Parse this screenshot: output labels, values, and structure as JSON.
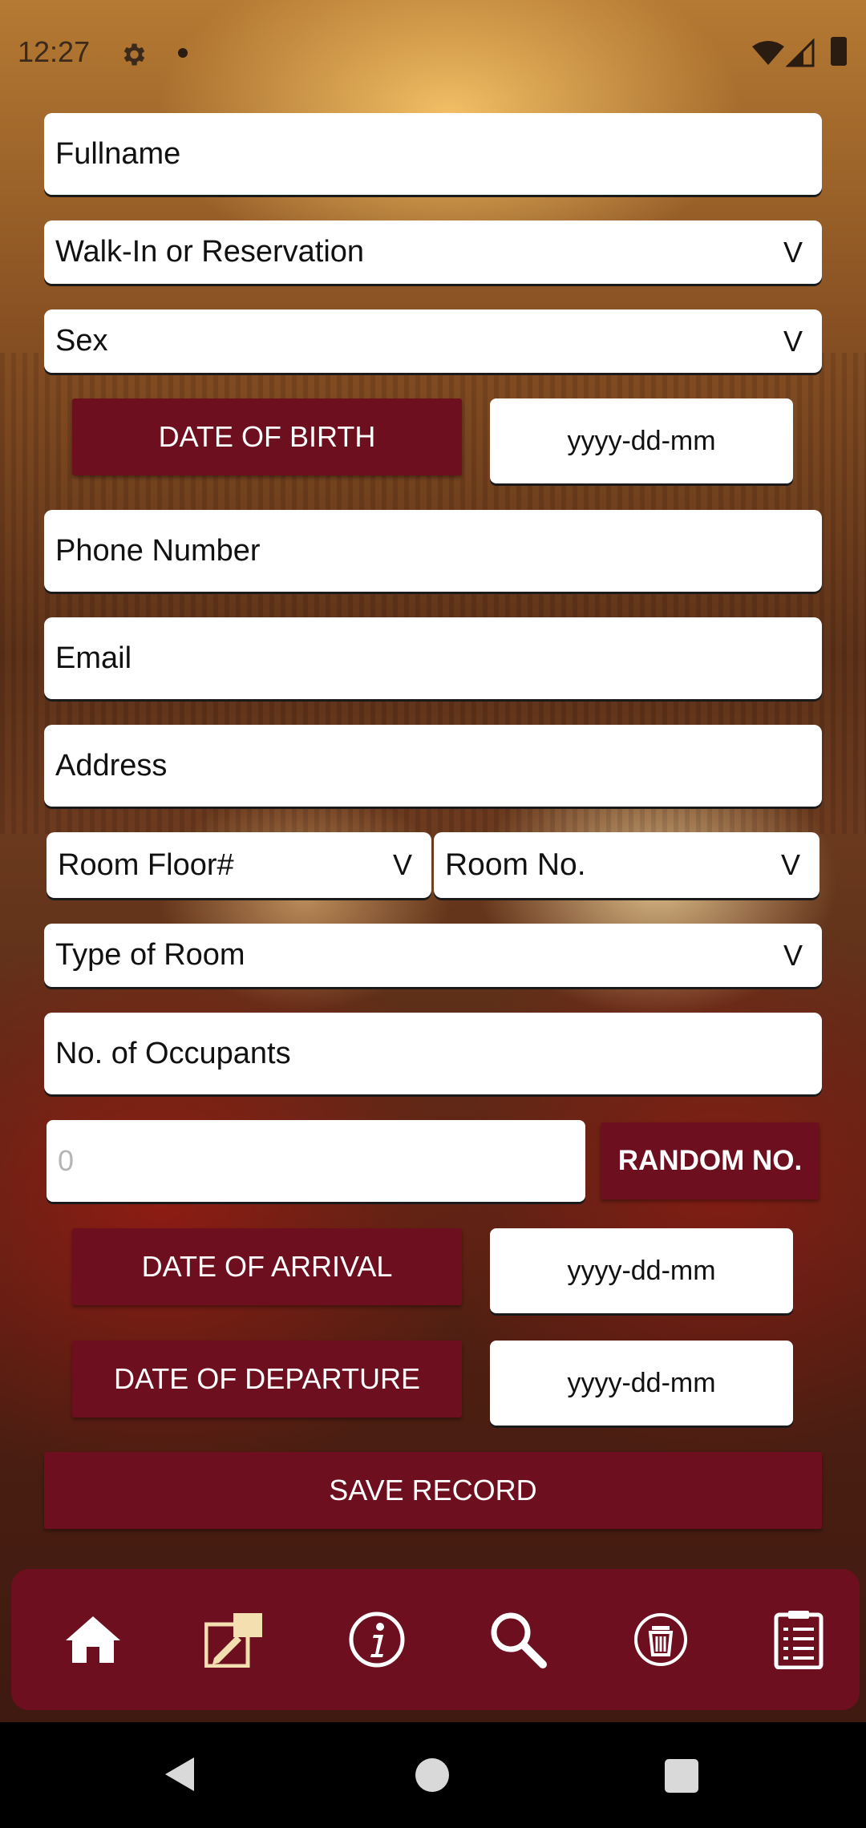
{
  "status_bar": {
    "time": "12:27",
    "icons": [
      "gear-icon",
      "notification-dot-icon",
      "wifi-icon",
      "signal-icon",
      "battery-icon"
    ]
  },
  "form": {
    "fullname_placeholder": "Fullname",
    "walkin_select": "Walk-In or Reservation",
    "sex_select": "Sex",
    "dropdown_marker": "V",
    "date_of_birth_button": "DATE OF BIRTH",
    "date_of_birth_value": "yyyy-dd-mm",
    "phone_placeholder": "Phone Number",
    "email_placeholder": "Email",
    "address_placeholder": "Address",
    "room_floor_select": "Room Floor#",
    "room_no_select": "Room No.",
    "room_type_select": "Type of Room",
    "occupants_placeholder": "No. of Occupants",
    "random_number_value": "0",
    "random_button": "RANDOM NO.",
    "date_of_arrival_button": "DATE OF ARRIVAL",
    "date_of_arrival_value": "yyyy-dd-mm",
    "date_of_departure_button": "DATE OF DEPARTURE",
    "date_of_departure_value": "yyyy-dd-mm",
    "save_button": "SAVE RECORD"
  },
  "bottom_nav": {
    "items": [
      "home-icon",
      "edit-record-icon",
      "info-icon",
      "search-icon",
      "delete-icon",
      "records-list-icon"
    ],
    "active": "edit-record-icon"
  },
  "colors": {
    "accent": "#6e0f1f",
    "active_icon": "#f3dfb0",
    "field_bg": "#ffffff"
  }
}
